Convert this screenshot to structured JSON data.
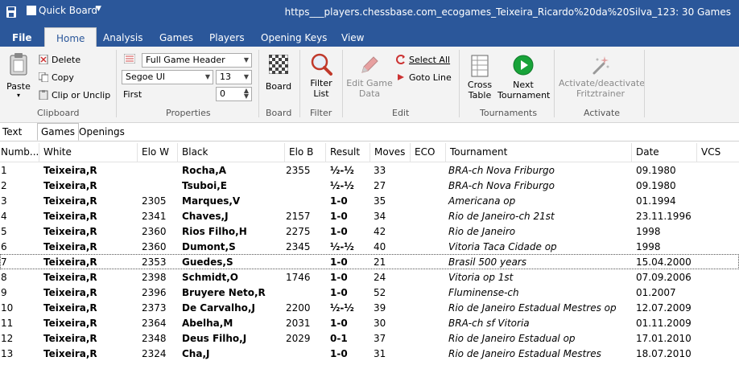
{
  "titlebar": {
    "quick_board": "Quick Board",
    "caret": "▼",
    "title": "https___players.chessbase.com_ecogames_Teixeira_Ricardo%20da%20Silva_123:  30 Games"
  },
  "tabs": {
    "file": "File",
    "home": "Home",
    "analysis": "Analysis",
    "games": "Games",
    "players": "Players",
    "opening_keys": "Opening Keys",
    "view": "View"
  },
  "ribbon": {
    "clipboard": {
      "paste": "Paste",
      "paste_caret": "▾",
      "delete": "Delete",
      "copy": "Copy",
      "clip": "Clip or Unclip",
      "label": "Clipboard"
    },
    "properties": {
      "header_select": "Full Game Header",
      "font_select": "Segoe UI",
      "size_select": "13",
      "first_label": "First",
      "first_value": "0",
      "label": "Properties"
    },
    "board": {
      "button": "Board",
      "label": "Board"
    },
    "filter": {
      "button_line1": "Filter",
      "button_line2": "List",
      "label": "Filter"
    },
    "edit": {
      "edit_game_line1": "Edit Game",
      "edit_game_line2": "Data",
      "select_all": "Select All",
      "goto_line": "Goto Line",
      "label": "Edit"
    },
    "tournaments": {
      "cross_line1": "Cross",
      "cross_line2": "Table",
      "next_line1": "Next",
      "next_line2": "Tournament",
      "label": "Tournaments"
    },
    "activate": {
      "btn_line1": "Activate/deactivate",
      "btn_line2": "Fritztrainer",
      "label": "Activate"
    }
  },
  "panel_tabs": {
    "text": "Text",
    "games": "Games",
    "openings": "Openings"
  },
  "columns": {
    "number": "Numb...",
    "white": "White",
    "elo_w": "Elo W",
    "black": "Black",
    "elo_b": "Elo B",
    "result": "Result",
    "moves": "Moves",
    "eco": "ECO",
    "tournament": "Tournament",
    "date": "Date",
    "vcs": "VCS"
  },
  "games": [
    {
      "n": "1",
      "white": "Teixeira,R",
      "elo_w": "",
      "black": "Rocha,A",
      "elo_b": "2355",
      "result": "½-½",
      "moves": "33",
      "eco": "",
      "tournament": "BRA-ch Nova Friburgo",
      "date": "09.1980"
    },
    {
      "n": "2",
      "white": "Teixeira,R",
      "elo_w": "",
      "black": "Tsuboi,E",
      "elo_b": "",
      "result": "½-½",
      "moves": "27",
      "eco": "",
      "tournament": "BRA-ch Nova Friburgo",
      "date": "09.1980"
    },
    {
      "n": "3",
      "white": "Teixeira,R",
      "elo_w": "2305",
      "black": "Marques,V",
      "elo_b": "",
      "result": "1-0",
      "moves": "35",
      "eco": "",
      "tournament": "Americana op",
      "date": "01.1994"
    },
    {
      "n": "4",
      "white": "Teixeira,R",
      "elo_w": "2341",
      "black": "Chaves,J",
      "elo_b": "2157",
      "result": "1-0",
      "moves": "34",
      "eco": "",
      "tournament": "Rio de Janeiro-ch 21st",
      "date": "23.11.1996"
    },
    {
      "n": "5",
      "white": "Teixeira,R",
      "elo_w": "2360",
      "black": "Rios Filho,H",
      "elo_b": "2275",
      "result": "1-0",
      "moves": "42",
      "eco": "",
      "tournament": "Rio de Janeiro",
      "date": "1998"
    },
    {
      "n": "6",
      "white": "Teixeira,R",
      "elo_w": "2360",
      "black": "Dumont,S",
      "elo_b": "2345",
      "result": "½-½",
      "moves": "40",
      "eco": "",
      "tournament": "Vitoria Taca Cidade op",
      "date": "1998"
    },
    {
      "n": "7",
      "white": "Teixeira,R",
      "elo_w": "2353",
      "black": "Guedes,S",
      "elo_b": "",
      "result": "1-0",
      "moves": "21",
      "eco": "",
      "tournament": "Brasil 500 years",
      "date": "15.04.2000"
    },
    {
      "n": "8",
      "white": "Teixeira,R",
      "elo_w": "2398",
      "black": "Schmidt,O",
      "elo_b": "1746",
      "result": "1-0",
      "moves": "24",
      "eco": "",
      "tournament": "Vitoria op 1st",
      "date": "07.09.2006"
    },
    {
      "n": "9",
      "white": "Teixeira,R",
      "elo_w": "2396",
      "black": "Bruyere Neto,R",
      "elo_b": "",
      "result": "1-0",
      "moves": "52",
      "eco": "",
      "tournament": "Fluminense-ch",
      "date": "01.2007"
    },
    {
      "n": "10",
      "white": "Teixeira,R",
      "elo_w": "2373",
      "black": "De Carvalho,J",
      "elo_b": "2200",
      "result": "½-½",
      "moves": "39",
      "eco": "",
      "tournament": "Rio de Janeiro Estadual Mestres op",
      "date": "12.07.2009"
    },
    {
      "n": "11",
      "white": "Teixeira,R",
      "elo_w": "2364",
      "black": "Abelha,M",
      "elo_b": "2031",
      "result": "1-0",
      "moves": "30",
      "eco": "",
      "tournament": "BRA-ch sf Vitoria",
      "date": "01.11.2009"
    },
    {
      "n": "12",
      "white": "Teixeira,R",
      "elo_w": "2348",
      "black": "Deus Filho,J",
      "elo_b": "2029",
      "result": "0-1",
      "moves": "37",
      "eco": "",
      "tournament": "Rio de Janeiro Estadual op",
      "date": "17.01.2010"
    },
    {
      "n": "13",
      "white": "Teixeira,R",
      "elo_w": "2324",
      "black": "Cha,J",
      "elo_b": "",
      "result": "1-0",
      "moves": "31",
      "eco": "",
      "tournament": "Rio de Janeiro Estadual Mestres",
      "date": "18.07.2010"
    }
  ],
  "selected_row": "7",
  "colors": {
    "accent": "#2b579a",
    "ribbon_bg": "#f3f3f3",
    "green": "#18a339",
    "red": "#cc2b2b"
  }
}
